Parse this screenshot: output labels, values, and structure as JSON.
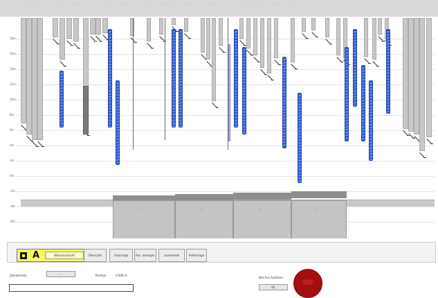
{
  "header": {
    "column_labels": [
      "· · ·",
      "· · ·",
      "· · ·",
      "· · ·",
      "· · ·",
      "· · ·",
      "· · ·",
      "· · ·",
      "· · ·",
      "· · ·",
      "· · ·",
      "· · ·",
      "· · ·",
      "· · ·",
      "· · ·",
      "· · ·",
      "· · ·",
      "· · ·",
      "· · ·",
      "· · ·",
      "· · ·",
      "· · ·",
      "· · ·",
      "· · ·",
      "· · ·",
      "· · ·",
      "· · ·",
      "· · ·",
      "· · ·",
      "· · ·",
      "· · ·",
      "· · ·",
      "· · ·",
      "· · ·",
      "· · ·",
      "· · ·",
      "· · ·",
      "· · ·",
      "· · ·",
      "· · ·",
      "· · ·",
      "· · ·",
      "· · ·",
      "· · ·"
    ]
  },
  "plot": {
    "y_labels": [
      "18m",
      "16m",
      "14m",
      "12m",
      "10m",
      "8m",
      "6m",
      "4m",
      "2m",
      "0m",
      "-2m",
      "-4m",
      "-6m"
    ],
    "platforms": [
      {
        "label": "···"
      },
      {
        "label": "···"
      },
      {
        "label": "···"
      },
      {
        "label": "···"
      }
    ]
  },
  "toolbar": {
    "main_icon_letter": "A",
    "main_label": "Bühnenansicht",
    "buttons": [
      {
        "label": "Übersicht"
      },
      {
        "label": "Unterzüge"
      },
      {
        "label": "Pos. anzeigen"
      },
      {
        "label": "Lastenwahl"
      },
      {
        "label": "Seitenzüge"
      }
    ]
  },
  "footer": {
    "speed_label": "Zylinderhub",
    "speed_button": "···",
    "position_label": "Position",
    "position_value": "0.000 m",
    "stop_label": "Not-Aus Auslösen",
    "stop_button": "Ok",
    "input_value": ""
  },
  "colors": {
    "blue_rod": "#2f5fd6",
    "gray_rod": "#c8c8c8",
    "estop": "#a50f0f",
    "highlight": "#f7f76a"
  }
}
